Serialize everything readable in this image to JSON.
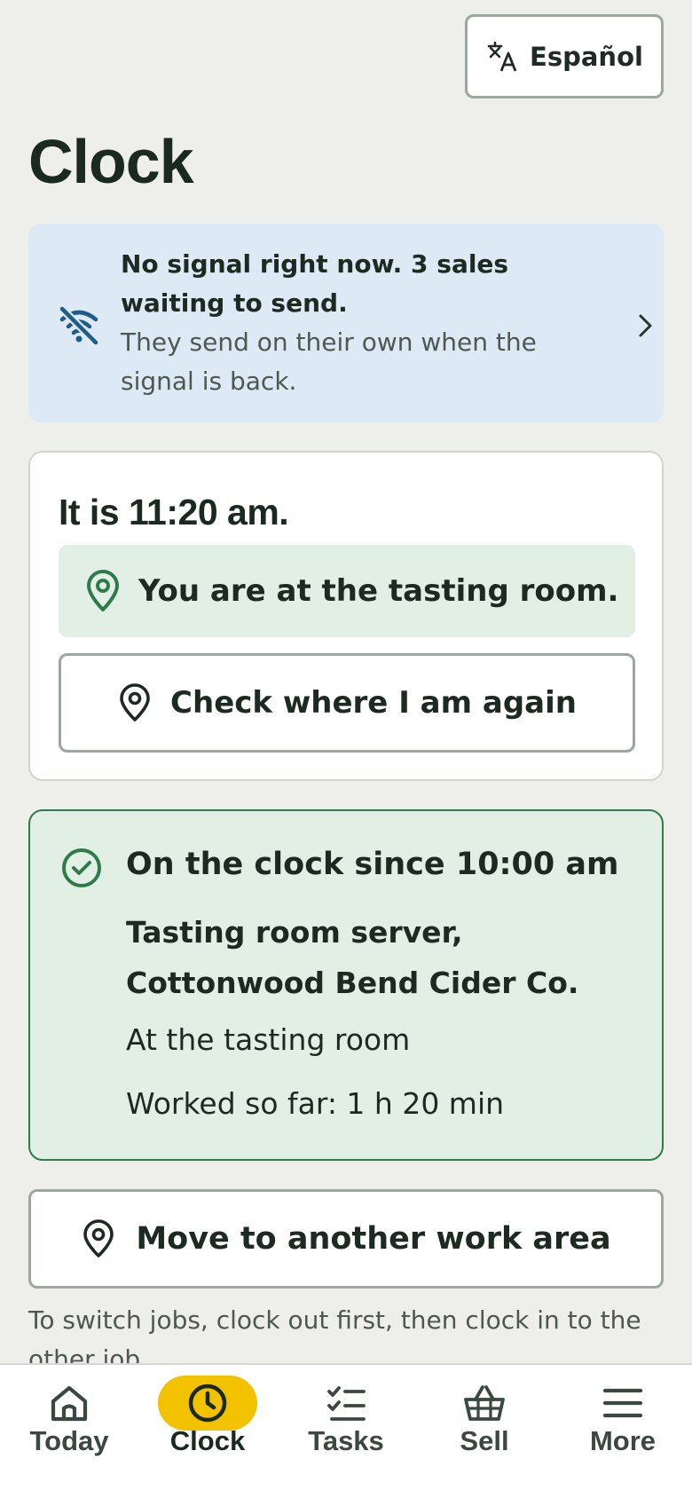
{
  "header": {
    "language_button": "Español",
    "title": "Clock"
  },
  "offline_banner": {
    "title": "No signal right now. 3 sales waiting to send.",
    "subtitle": "They send on their own when the signal is back."
  },
  "time_card": {
    "time_text": "It is 11:20 am.",
    "location_status": "You are at the tasting room.",
    "check_location_button": "Check where I am again"
  },
  "clock_status": {
    "title": "On the clock since 10:00 am",
    "job": "Tasting room server, Cottonwood Bend Cider Co.",
    "work_area": "At the tasting room",
    "worked": "Worked so far: 1 h 20 min"
  },
  "move_button": "Move to another work area",
  "hint": "To switch jobs, clock out first, then clock in to the other job.",
  "bottom_nav": {
    "items": [
      {
        "label": "Today",
        "icon": "home-icon"
      },
      {
        "label": "Clock",
        "icon": "clock-icon",
        "active": true
      },
      {
        "label": "Tasks",
        "icon": "checklist-icon"
      },
      {
        "label": "Sell",
        "icon": "basket-icon"
      },
      {
        "label": "More",
        "icon": "menu-icon"
      }
    ]
  },
  "colors": {
    "background": "#eeeeea",
    "banner": "#dde9f4",
    "success_bg": "#e1efe5",
    "success_accent": "#2f7a4a",
    "nav_active": "#f2c100",
    "offline_icon": "#1f5c8a"
  }
}
